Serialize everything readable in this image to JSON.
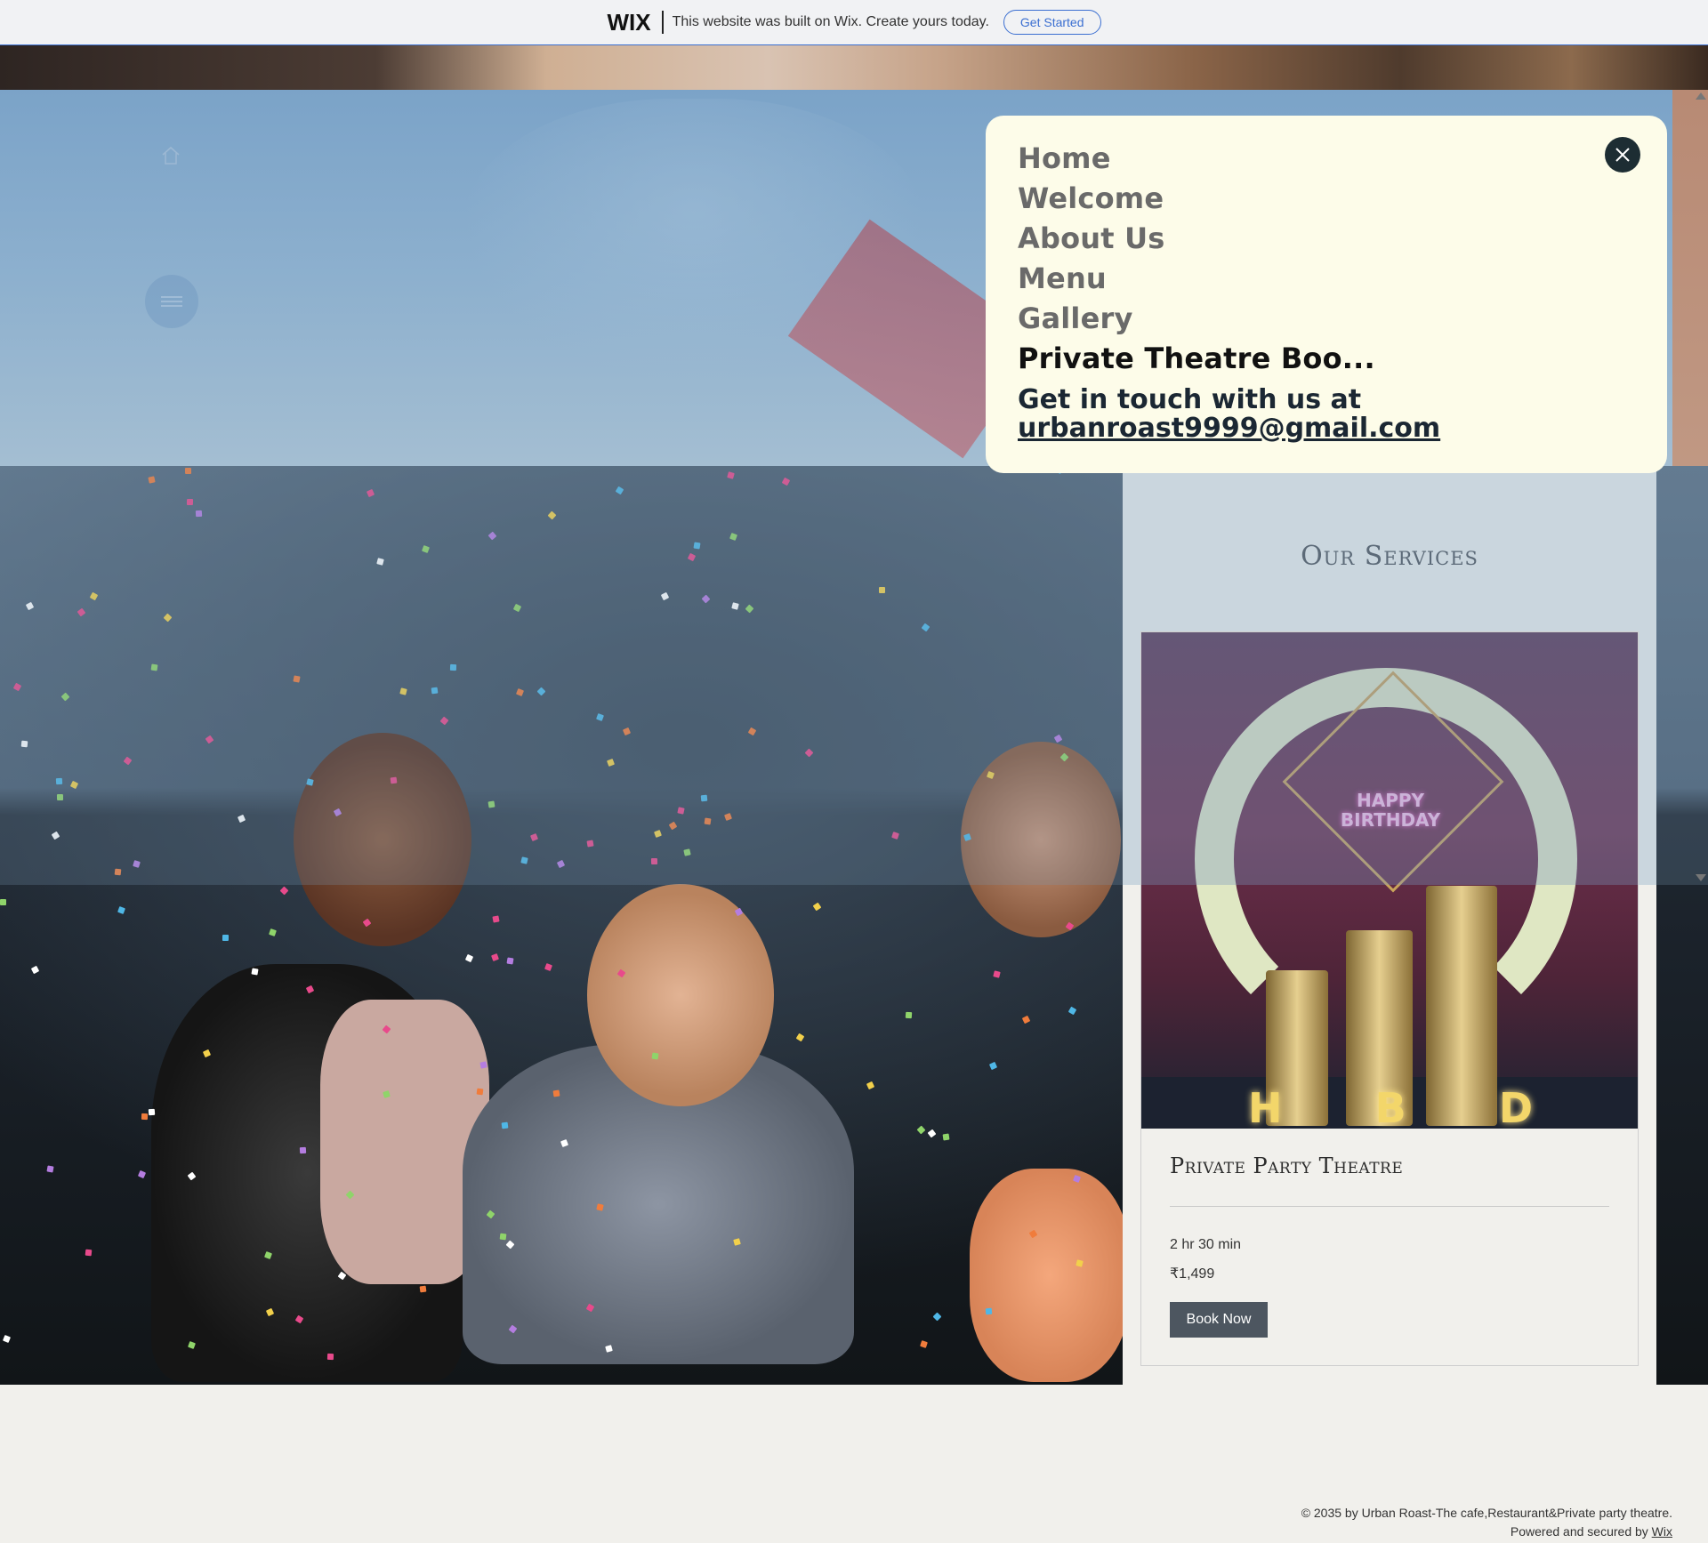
{
  "wix_banner": {
    "logo": "WIX",
    "text": "This website was built on Wix. Create yours today.",
    "button": "Get Started"
  },
  "icons": {
    "home": "home-icon",
    "menu": "hamburger-menu-icon",
    "close": "close-icon"
  },
  "menu": {
    "items": [
      {
        "label": "Home",
        "active": false
      },
      {
        "label": "Welcome",
        "active": false
      },
      {
        "label": "About Us",
        "active": false
      },
      {
        "label": "Menu",
        "active": false
      },
      {
        "label": "Gallery",
        "active": false
      },
      {
        "label": "Private Theatre Boo...",
        "active": true
      }
    ],
    "contact_line": "Get in touch with us at",
    "contact_email": "urbanroast9999@gmail.com"
  },
  "services": {
    "title": "Our Services",
    "card": {
      "image_neon_text": "HAPPY BIRTHDAY",
      "image_letters": [
        "H",
        "B",
        "D"
      ],
      "name": "Private Party Theatre",
      "duration": "2 hr 30 min",
      "price": "₹1,499",
      "button": "Book Now"
    }
  },
  "footer": {
    "copyright": "© 2035 by Urban Roast-The cafe,Restaurant&Private party theatre.",
    "powered_prefix": "Powered and secured by",
    "powered_link": "Wix"
  },
  "colors": {
    "wix_accent": "#3b6fd1",
    "menu_bg": "#fdfce9",
    "close_btn": "#1d2d33",
    "book_btn": "#4d5660",
    "page_bg": "#f1f0ec"
  }
}
